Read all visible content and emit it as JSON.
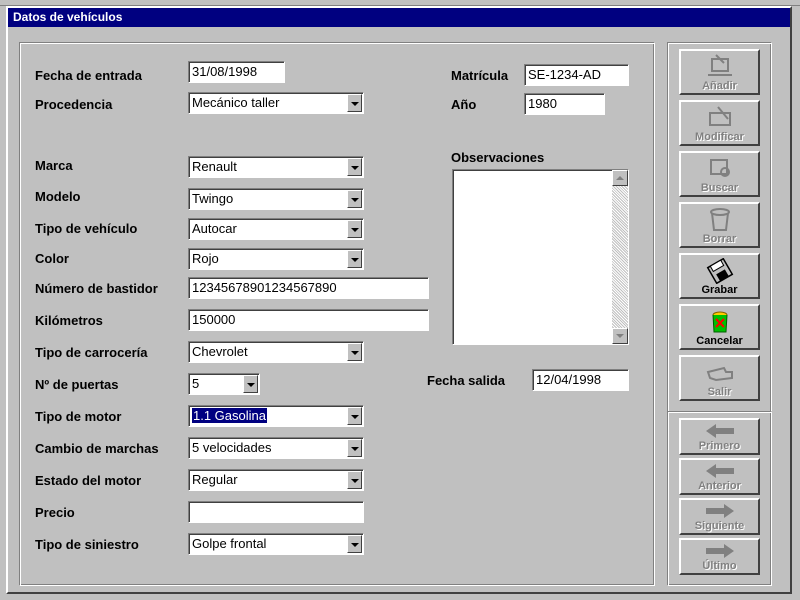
{
  "window": {
    "title": "Datos de vehículos"
  },
  "form": {
    "fecha_entrada": {
      "label": "Fecha de entrada",
      "value": "31/08/1998"
    },
    "procedencia": {
      "label": "Procedencia",
      "value": "Mecánico taller"
    },
    "marca": {
      "label": "Marca",
      "value": "Renault"
    },
    "modelo": {
      "label": "Modelo",
      "value": "Twingo"
    },
    "tipo_vehiculo": {
      "label": "Tipo de vehículo",
      "value": "Autocar"
    },
    "color": {
      "label": "Color",
      "value": "Rojo"
    },
    "bastidor": {
      "label": "Número de bastidor",
      "value": "12345678901234567890"
    },
    "kilometros": {
      "label": "Kilómetros",
      "value": "150000"
    },
    "carroceria": {
      "label": "Tipo de carrocería",
      "value": "Chevrolet"
    },
    "puertas": {
      "label": "Nº de puertas",
      "value": "5"
    },
    "motor": {
      "label": "Tipo de motor",
      "value": "1.1 Gasolina"
    },
    "cambio": {
      "label": "Cambio de marchas",
      "value": "5 velocidades"
    },
    "estado_motor": {
      "label": "Estado del motor",
      "value": "Regular"
    },
    "precio": {
      "label": "Precio",
      "value": ""
    },
    "siniestro": {
      "label": "Tipo de siniestro",
      "value": "Golpe frontal"
    },
    "matricula": {
      "label": "Matrícula",
      "value": "SE-1234-AD"
    },
    "anio": {
      "label": "Año",
      "value": "1980"
    },
    "observaciones": {
      "label": "Observaciones",
      "value": ""
    },
    "fecha_salida": {
      "label": "Fecha salida",
      "value": "12/04/1998"
    }
  },
  "toolbar": {
    "anadir": "Añadir",
    "modificar": "Modificar",
    "buscar": "Buscar",
    "borrar": "Borrar",
    "grabar": "Grabar",
    "cancelar": "Cancelar",
    "salir": "Salir"
  },
  "navigation": {
    "primero": "Primero",
    "anterior": "Anterior",
    "siguiente": "Siguiente",
    "ultimo": "Último"
  },
  "icons": {
    "anadir": "add-record-icon",
    "modificar": "edit-record-icon",
    "buscar": "search-icon",
    "borrar": "trash-icon",
    "grabar": "floppy-disk-icon",
    "cancelar": "cancel-bin-icon",
    "salir": "exit-hand-icon",
    "primero": "arrow-left-icon",
    "anterior": "arrow-left-icon",
    "siguiente": "arrow-right-icon",
    "ultimo": "arrow-right-icon"
  },
  "colors": {
    "title_bar": "#000080",
    "window_bg": "#c0c0c0",
    "selection": "#000080",
    "disabled_text": "#808080"
  }
}
